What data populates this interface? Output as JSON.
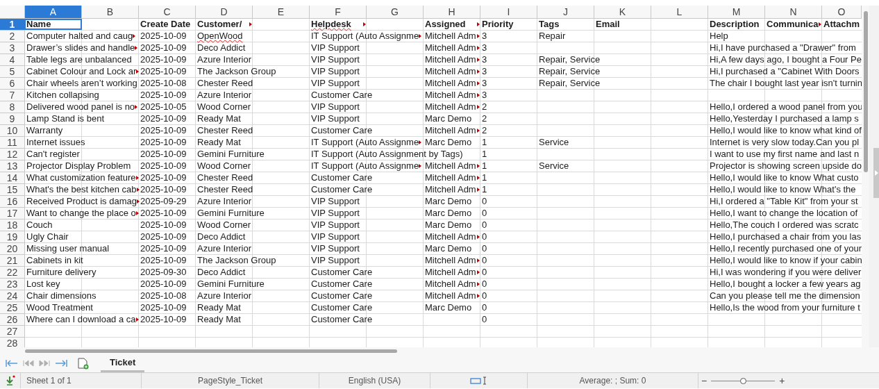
{
  "columns": [
    {
      "label": "A",
      "selected": true
    },
    {
      "label": "B",
      "selected": false
    },
    {
      "label": "C",
      "selected": false
    },
    {
      "label": "D",
      "selected": false
    },
    {
      "label": "E",
      "selected": false
    },
    {
      "label": "F",
      "selected": false
    },
    {
      "label": "G",
      "selected": false
    },
    {
      "label": "H",
      "selected": false
    },
    {
      "label": "I",
      "selected": false
    },
    {
      "label": "J",
      "selected": false
    },
    {
      "label": "K",
      "selected": false
    },
    {
      "label": "L",
      "selected": false
    },
    {
      "label": "M",
      "selected": false
    },
    {
      "label": "N",
      "selected": false
    },
    {
      "label": "O",
      "selected": false
    }
  ],
  "rows": [
    {
      "number": "1",
      "selected": true,
      "kind": "header",
      "cells": {
        "A": {
          "text": "Name",
          "truncated": false,
          "misspelled": false
        },
        "C": {
          "text": "Create Date",
          "truncated": false,
          "misspelled": false
        },
        "D": {
          "text": "Customer/",
          "truncated": true,
          "misspelled": false
        },
        "F": {
          "text": "Helpdesk",
          "truncated": true,
          "misspelled": true
        },
        "H": {
          "text": "Assigned",
          "truncated": true,
          "misspelled": false
        },
        "I": {
          "text": "Priority",
          "truncated": false,
          "misspelled": false
        },
        "J": {
          "text": "Tags",
          "truncated": false,
          "misspelled": false
        },
        "K": {
          "text": "Email",
          "truncated": false,
          "misspelled": false
        },
        "M": {
          "text": "Description",
          "truncated": false,
          "misspelled": false
        },
        "N": {
          "text": "Communica",
          "truncated": true,
          "misspelled": false
        },
        "O": {
          "text": "Attachm",
          "truncated": false,
          "misspelled": false
        }
      }
    },
    {
      "number": "2",
      "selected": false,
      "kind": "data",
      "cells": {
        "A": {
          "text": "Computer halted and caug",
          "truncated": true,
          "misspelled": false
        },
        "C": {
          "text": "2025-10-09",
          "truncated": false,
          "misspelled": false
        },
        "D": {
          "text": "OpenWood",
          "truncated": false,
          "misspelled": true
        },
        "F": {
          "text": "IT Support (Auto Assignme",
          "truncated": true,
          "misspelled": false
        },
        "H": {
          "text": "Mitchell Adm",
          "truncated": true,
          "misspelled": false
        },
        "I": {
          "text": "3",
          "truncated": false,
          "misspelled": false
        },
        "J": {
          "text": "Repair",
          "truncated": false,
          "misspelled": false
        },
        "M": {
          "text": "Help",
          "truncated": false,
          "misspelled": false
        }
      }
    },
    {
      "number": "3",
      "selected": false,
      "kind": "data",
      "cells": {
        "A": {
          "text": "Drawer’s slides and handle",
          "truncated": true,
          "misspelled": false
        },
        "C": {
          "text": "2025-10-09",
          "truncated": false,
          "misspelled": false
        },
        "D": {
          "text": "Deco Addict",
          "truncated": false,
          "misspelled": false
        },
        "F": {
          "text": "VIP Support",
          "truncated": false,
          "misspelled": false
        },
        "H": {
          "text": "Mitchell Adm",
          "truncated": true,
          "misspelled": false
        },
        "I": {
          "text": "3",
          "truncated": false,
          "misspelled": false
        },
        "M": {
          "text": "Hi,I have purchased a \"Drawer\" from",
          "truncated": false,
          "misspelled": false
        }
      }
    },
    {
      "number": "4",
      "selected": false,
      "kind": "data",
      "cells": {
        "A": {
          "text": "Table legs are unbalanced",
          "truncated": false,
          "misspelled": false
        },
        "C": {
          "text": "2025-10-09",
          "truncated": false,
          "misspelled": false
        },
        "D": {
          "text": "Azure Interior",
          "truncated": false,
          "misspelled": false
        },
        "F": {
          "text": "VIP Support",
          "truncated": false,
          "misspelled": false
        },
        "H": {
          "text": "Mitchell Adm",
          "truncated": true,
          "misspelled": false
        },
        "I": {
          "text": "3",
          "truncated": false,
          "misspelled": false
        },
        "J": {
          "text": "Repair, Service",
          "truncated": false,
          "misspelled": false
        },
        "M": {
          "text": "Hi,A few days ago, I bought a Four Pe",
          "truncated": false,
          "misspelled": false
        }
      }
    },
    {
      "number": "5",
      "selected": false,
      "kind": "data",
      "cells": {
        "A": {
          "text": "Cabinet Colour and Lock ar",
          "truncated": true,
          "misspelled": false
        },
        "C": {
          "text": "2025-10-09",
          "truncated": false,
          "misspelled": false
        },
        "D": {
          "text": "The Jackson Group",
          "truncated": false,
          "misspelled": false
        },
        "F": {
          "text": "VIP Support",
          "truncated": false,
          "misspelled": false
        },
        "H": {
          "text": "Mitchell Adm",
          "truncated": true,
          "misspelled": false
        },
        "I": {
          "text": "3",
          "truncated": false,
          "misspelled": false
        },
        "J": {
          "text": "Repair, Service",
          "truncated": false,
          "misspelled": false
        },
        "M": {
          "text": "Hi,I purchased a \"Cabinet With Doors",
          "truncated": false,
          "misspelled": false
        }
      }
    },
    {
      "number": "6",
      "selected": false,
      "kind": "data",
      "cells": {
        "A": {
          "text": "Chair wheels aren’t working",
          "truncated": false,
          "misspelled": false
        },
        "C": {
          "text": "2025-10-08",
          "truncated": false,
          "misspelled": false
        },
        "D": {
          "text": "Chester Reed",
          "truncated": false,
          "misspelled": false
        },
        "F": {
          "text": "VIP Support",
          "truncated": false,
          "misspelled": false
        },
        "H": {
          "text": "Mitchell Adm",
          "truncated": true,
          "misspelled": false
        },
        "I": {
          "text": "3",
          "truncated": false,
          "misspelled": false
        },
        "J": {
          "text": "Repair, Service",
          "truncated": false,
          "misspelled": false
        },
        "M": {
          "text": "The chair I bought last year isn't turnin",
          "truncated": false,
          "misspelled": false
        }
      }
    },
    {
      "number": "7",
      "selected": false,
      "kind": "data",
      "cells": {
        "A": {
          "text": "Kitchen collapsing",
          "truncated": false,
          "misspelled": false
        },
        "C": {
          "text": "2025-10-09",
          "truncated": false,
          "misspelled": false
        },
        "D": {
          "text": "Azure Interior",
          "truncated": false,
          "misspelled": false
        },
        "F": {
          "text": "Customer Care",
          "truncated": false,
          "misspelled": false
        },
        "H": {
          "text": "Mitchell Adm",
          "truncated": true,
          "misspelled": false
        },
        "I": {
          "text": "3",
          "truncated": false,
          "misspelled": false
        }
      }
    },
    {
      "number": "8",
      "selected": false,
      "kind": "data",
      "cells": {
        "A": {
          "text": "Delivered wood panel is no",
          "truncated": true,
          "misspelled": false
        },
        "C": {
          "text": "2025-10-05",
          "truncated": false,
          "misspelled": false
        },
        "D": {
          "text": "Wood Corner",
          "truncated": false,
          "misspelled": false
        },
        "F": {
          "text": "VIP Support",
          "truncated": false,
          "misspelled": false
        },
        "H": {
          "text": "Mitchell Adm",
          "truncated": true,
          "misspelled": false
        },
        "I": {
          "text": "2",
          "truncated": false,
          "misspelled": false
        },
        "M": {
          "text": "Hello,I ordered a wood panel from you",
          "truncated": false,
          "misspelled": false
        }
      }
    },
    {
      "number": "9",
      "selected": false,
      "kind": "data",
      "cells": {
        "A": {
          "text": "Lamp Stand is bent",
          "truncated": false,
          "misspelled": false
        },
        "C": {
          "text": "2025-10-09",
          "truncated": false,
          "misspelled": false
        },
        "D": {
          "text": "Ready Mat",
          "truncated": false,
          "misspelled": false
        },
        "F": {
          "text": "VIP Support",
          "truncated": false,
          "misspelled": false
        },
        "H": {
          "text": "Marc Demo",
          "truncated": false,
          "misspelled": false
        },
        "I": {
          "text": "2",
          "truncated": false,
          "misspelled": false
        },
        "M": {
          "text": "Hello,Yesterday I purchased a lamp s",
          "truncated": false,
          "misspelled": false
        }
      }
    },
    {
      "number": "10",
      "selected": false,
      "kind": "data",
      "cells": {
        "A": {
          "text": "Warranty",
          "truncated": false,
          "misspelled": false
        },
        "C": {
          "text": "2025-10-09",
          "truncated": false,
          "misspelled": false
        },
        "D": {
          "text": "Chester Reed",
          "truncated": false,
          "misspelled": false
        },
        "F": {
          "text": "Customer Care",
          "truncated": false,
          "misspelled": false
        },
        "H": {
          "text": "Mitchell Adm",
          "truncated": true,
          "misspelled": false
        },
        "I": {
          "text": "2",
          "truncated": false,
          "misspelled": false
        },
        "M": {
          "text": "Hello,I would like to know what kind of",
          "truncated": false,
          "misspelled": false
        }
      }
    },
    {
      "number": "11",
      "selected": false,
      "kind": "data",
      "cells": {
        "A": {
          "text": "Internet issues",
          "truncated": false,
          "misspelled": false
        },
        "C": {
          "text": "2025-10-09",
          "truncated": false,
          "misspelled": false
        },
        "D": {
          "text": "Ready Mat",
          "truncated": false,
          "misspelled": false
        },
        "F": {
          "text": "IT Support (Auto Assignme",
          "truncated": true,
          "misspelled": false
        },
        "H": {
          "text": "Marc Demo",
          "truncated": false,
          "misspelled": false
        },
        "I": {
          "text": "1",
          "truncated": false,
          "misspelled": false
        },
        "J": {
          "text": "Service",
          "truncated": false,
          "misspelled": false
        },
        "M": {
          "text": "Internet is very slow today.Can you pl",
          "truncated": false,
          "misspelled": false
        }
      }
    },
    {
      "number": "12",
      "selected": false,
      "kind": "data",
      "cells": {
        "A": {
          "text": "Can't register",
          "truncated": false,
          "misspelled": false
        },
        "C": {
          "text": "2025-10-09",
          "truncated": false,
          "misspelled": false
        },
        "D": {
          "text": "Gemini Furniture",
          "truncated": false,
          "misspelled": false
        },
        "F": {
          "text": "IT Support (Auto Assignment by Tags)",
          "truncated": false,
          "misspelled": false
        },
        "I": {
          "text": "1",
          "truncated": false,
          "misspelled": false
        },
        "M": {
          "text": "I want to use my first name and last n",
          "truncated": false,
          "misspelled": false
        }
      }
    },
    {
      "number": "13",
      "selected": false,
      "kind": "data",
      "cells": {
        "A": {
          "text": "Projector Display Problem",
          "truncated": false,
          "misspelled": false
        },
        "C": {
          "text": "2025-10-09",
          "truncated": false,
          "misspelled": false
        },
        "D": {
          "text": "Wood Corner",
          "truncated": false,
          "misspelled": false
        },
        "F": {
          "text": "IT Support (Auto Assignme",
          "truncated": true,
          "misspelled": false
        },
        "H": {
          "text": "Mitchell Adm",
          "truncated": true,
          "misspelled": false
        },
        "I": {
          "text": "1",
          "truncated": false,
          "misspelled": false
        },
        "J": {
          "text": "Service",
          "truncated": false,
          "misspelled": false
        },
        "M": {
          "text": "Projector is showing screen upside do",
          "truncated": false,
          "misspelled": false
        }
      }
    },
    {
      "number": "14",
      "selected": false,
      "kind": "data",
      "cells": {
        "A": {
          "text": "What customization feature",
          "truncated": true,
          "misspelled": false
        },
        "C": {
          "text": "2025-10-09",
          "truncated": false,
          "misspelled": false
        },
        "D": {
          "text": "Chester Reed",
          "truncated": false,
          "misspelled": false
        },
        "F": {
          "text": "Customer Care",
          "truncated": false,
          "misspelled": false
        },
        "H": {
          "text": "Mitchell Adm",
          "truncated": true,
          "misspelled": false
        },
        "I": {
          "text": "1",
          "truncated": false,
          "misspelled": false
        },
        "M": {
          "text": "Hello,I would like to know What custo",
          "truncated": false,
          "misspelled": false
        }
      }
    },
    {
      "number": "15",
      "selected": false,
      "kind": "data",
      "cells": {
        "A": {
          "text": "What's the best kitchen cab",
          "truncated": true,
          "misspelled": false
        },
        "C": {
          "text": "2025-10-09",
          "truncated": false,
          "misspelled": false
        },
        "D": {
          "text": "Chester Reed",
          "truncated": false,
          "misspelled": false
        },
        "F": {
          "text": "Customer Care",
          "truncated": false,
          "misspelled": false
        },
        "H": {
          "text": "Mitchell Adm",
          "truncated": true,
          "misspelled": false
        },
        "I": {
          "text": "1",
          "truncated": false,
          "misspelled": false
        },
        "M": {
          "text": "Hello,I would like to know What's the",
          "truncated": false,
          "misspelled": false
        }
      }
    },
    {
      "number": "16",
      "selected": false,
      "kind": "data",
      "cells": {
        "A": {
          "text": "Received Product is damag",
          "truncated": true,
          "misspelled": false
        },
        "C": {
          "text": "2025-09-29",
          "truncated": false,
          "misspelled": false
        },
        "D": {
          "text": "Azure Interior",
          "truncated": false,
          "misspelled": false
        },
        "F": {
          "text": "VIP Support",
          "truncated": false,
          "misspelled": false
        },
        "H": {
          "text": "Marc Demo",
          "truncated": false,
          "misspelled": false
        },
        "I": {
          "text": "0",
          "truncated": false,
          "misspelled": false
        },
        "M": {
          "text": "Hi,I ordered a \"Table Kit\" from your st",
          "truncated": false,
          "misspelled": false
        }
      }
    },
    {
      "number": "17",
      "selected": false,
      "kind": "data",
      "cells": {
        "A": {
          "text": "Want to change the place o",
          "truncated": true,
          "misspelled": false
        },
        "C": {
          "text": "2025-10-09",
          "truncated": false,
          "misspelled": false
        },
        "D": {
          "text": "Gemini Furniture",
          "truncated": false,
          "misspelled": false
        },
        "F": {
          "text": "VIP Support",
          "truncated": false,
          "misspelled": false
        },
        "H": {
          "text": "Marc Demo",
          "truncated": false,
          "misspelled": false
        },
        "I": {
          "text": "0",
          "truncated": false,
          "misspelled": false
        },
        "M": {
          "text": "Hello,I want to change the location of",
          "truncated": false,
          "misspelled": false
        }
      }
    },
    {
      "number": "18",
      "selected": false,
      "kind": "data",
      "cells": {
        "A": {
          "text": "Couch",
          "truncated": false,
          "misspelled": false
        },
        "C": {
          "text": "2025-10-09",
          "truncated": false,
          "misspelled": false
        },
        "D": {
          "text": "Wood Corner",
          "truncated": false,
          "misspelled": false
        },
        "F": {
          "text": "VIP Support",
          "truncated": false,
          "misspelled": false
        },
        "H": {
          "text": "Marc Demo",
          "truncated": false,
          "misspelled": false
        },
        "I": {
          "text": "0",
          "truncated": false,
          "misspelled": false
        },
        "M": {
          "text": "Hello,The couch I ordered was scratc",
          "truncated": false,
          "misspelled": false
        }
      }
    },
    {
      "number": "19",
      "selected": false,
      "kind": "data",
      "cells": {
        "A": {
          "text": "Ugly Chair",
          "truncated": false,
          "misspelled": false
        },
        "C": {
          "text": "2025-10-09",
          "truncated": false,
          "misspelled": false
        },
        "D": {
          "text": "Deco Addict",
          "truncated": false,
          "misspelled": false
        },
        "F": {
          "text": "VIP Support",
          "truncated": false,
          "misspelled": false
        },
        "H": {
          "text": "Mitchell Adm",
          "truncated": true,
          "misspelled": false
        },
        "I": {
          "text": "0",
          "truncated": false,
          "misspelled": false
        },
        "M": {
          "text": "Hello,I purchased a chair from you las",
          "truncated": false,
          "misspelled": false
        }
      }
    },
    {
      "number": "20",
      "selected": false,
      "kind": "data",
      "cells": {
        "A": {
          "text": "Missing user manual",
          "truncated": false,
          "misspelled": false
        },
        "C": {
          "text": "2025-10-09",
          "truncated": false,
          "misspelled": false
        },
        "D": {
          "text": "Azure Interior",
          "truncated": false,
          "misspelled": false
        },
        "F": {
          "text": "VIP Support",
          "truncated": false,
          "misspelled": false
        },
        "H": {
          "text": "Marc Demo",
          "truncated": false,
          "misspelled": false
        },
        "I": {
          "text": "0",
          "truncated": false,
          "misspelled": false
        },
        "M": {
          "text": "Hello,I recently purchased one of your",
          "truncated": false,
          "misspelled": false
        }
      }
    },
    {
      "number": "21",
      "selected": false,
      "kind": "data",
      "cells": {
        "A": {
          "text": "Cabinets in kit",
          "truncated": false,
          "misspelled": false
        },
        "C": {
          "text": "2025-10-09",
          "truncated": false,
          "misspelled": false
        },
        "D": {
          "text": "The Jackson Group",
          "truncated": false,
          "misspelled": false
        },
        "F": {
          "text": "VIP Support",
          "truncated": false,
          "misspelled": false
        },
        "H": {
          "text": "Mitchell Adm",
          "truncated": true,
          "misspelled": false
        },
        "I": {
          "text": "0",
          "truncated": false,
          "misspelled": false
        },
        "M": {
          "text": "Hello,I would like to know if your cabin",
          "truncated": false,
          "misspelled": false
        }
      }
    },
    {
      "number": "22",
      "selected": false,
      "kind": "data",
      "cells": {
        "A": {
          "text": "Furniture delivery",
          "truncated": false,
          "misspelled": false
        },
        "C": {
          "text": "2025-09-30",
          "truncated": false,
          "misspelled": false
        },
        "D": {
          "text": "Deco Addict",
          "truncated": false,
          "misspelled": false
        },
        "F": {
          "text": "Customer Care",
          "truncated": false,
          "misspelled": false
        },
        "H": {
          "text": "Mitchell Adm",
          "truncated": true,
          "misspelled": false
        },
        "I": {
          "text": "0",
          "truncated": false,
          "misspelled": false
        },
        "M": {
          "text": "Hi,I was wondering if you were deliver",
          "truncated": false,
          "misspelled": false
        }
      }
    },
    {
      "number": "23",
      "selected": false,
      "kind": "data",
      "cells": {
        "A": {
          "text": "Lost key",
          "truncated": false,
          "misspelled": false
        },
        "C": {
          "text": "2025-10-09",
          "truncated": false,
          "misspelled": false
        },
        "D": {
          "text": "Gemini Furniture",
          "truncated": false,
          "misspelled": false
        },
        "F": {
          "text": "Customer Care",
          "truncated": false,
          "misspelled": false
        },
        "H": {
          "text": "Mitchell Adm",
          "truncated": true,
          "misspelled": false
        },
        "I": {
          "text": "0",
          "truncated": false,
          "misspelled": false
        },
        "M": {
          "text": "Hello,I bought a locker a few years ag",
          "truncated": false,
          "misspelled": false
        }
      }
    },
    {
      "number": "24",
      "selected": false,
      "kind": "data",
      "cells": {
        "A": {
          "text": "Chair dimensions",
          "truncated": false,
          "misspelled": false
        },
        "C": {
          "text": "2025-10-08",
          "truncated": false,
          "misspelled": false
        },
        "D": {
          "text": "Azure Interior",
          "truncated": false,
          "misspelled": false
        },
        "F": {
          "text": "Customer Care",
          "truncated": false,
          "misspelled": false
        },
        "H": {
          "text": "Mitchell Adm",
          "truncated": true,
          "misspelled": false
        },
        "I": {
          "text": "0",
          "truncated": false,
          "misspelled": false
        },
        "M": {
          "text": "Can you please tell me the dimension",
          "truncated": false,
          "misspelled": false
        }
      }
    },
    {
      "number": "25",
      "selected": false,
      "kind": "data",
      "cells": {
        "A": {
          "text": "Wood Treatment",
          "truncated": false,
          "misspelled": false
        },
        "C": {
          "text": "2025-10-09",
          "truncated": false,
          "misspelled": false
        },
        "D": {
          "text": "Ready Mat",
          "truncated": false,
          "misspelled": false
        },
        "F": {
          "text": "Customer Care",
          "truncated": false,
          "misspelled": false
        },
        "H": {
          "text": "Marc Demo",
          "truncated": false,
          "misspelled": false
        },
        "I": {
          "text": "0",
          "truncated": false,
          "misspelled": false
        },
        "M": {
          "text": "Hello,Is the wood from your furniture t",
          "truncated": false,
          "misspelled": false
        }
      }
    },
    {
      "number": "26",
      "selected": false,
      "kind": "data",
      "cells": {
        "A": {
          "text": "Where can I download a ca",
          "truncated": true,
          "misspelled": false
        },
        "C": {
          "text": "2025-10-09",
          "truncated": false,
          "misspelled": false
        },
        "D": {
          "text": "Ready Mat",
          "truncated": false,
          "misspelled": false
        },
        "F": {
          "text": "Customer Care",
          "truncated": false,
          "misspelled": false
        },
        "I": {
          "text": "0",
          "truncated": false,
          "misspelled": false
        }
      }
    },
    {
      "number": "27",
      "selected": false,
      "kind": "data"
    },
    {
      "number": "28",
      "selected": false,
      "kind": "data"
    }
  ],
  "sheet_tabs": [
    {
      "label": "Ticket",
      "selected": true
    }
  ],
  "status_bar": {
    "sheet": "Sheet 1 of 1",
    "page_style": "PageStyle_Ticket",
    "language": "English (USA)",
    "summary": "Average: ; Sum: 0"
  },
  "zoom": {
    "out": "−",
    "in": "+",
    "level": 0.5
  }
}
